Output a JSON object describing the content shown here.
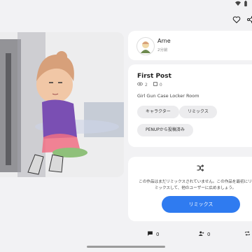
{
  "status_icons": [
    "wifi-icon",
    "battery-icon"
  ],
  "toolbar": {
    "like_icon": "heart-icon",
    "share_icon": "share-icon"
  },
  "author": {
    "name": "Arne",
    "time": "2分前"
  },
  "post": {
    "title": "First Post",
    "view_count": "2",
    "comment_count": "0",
    "description": "Girl Gun Case Locker Room",
    "tags": [
      "キャラクター",
      "リミックス",
      "PENUPから投稿済み"
    ]
  },
  "remix": {
    "icon": "shuffle-icon",
    "message": "この作品はまだリミックスされていません。この作品を最初にリミックスして、他のユーザーに広めましょう。",
    "button_label": "リミックス"
  },
  "bottom_bar": {
    "comment_count": "0",
    "user_count": "0"
  },
  "colors": {
    "accent": "#2f7bf0",
    "background": "#f2f2f4",
    "card": "#ffffff",
    "chip": "#ececee"
  }
}
